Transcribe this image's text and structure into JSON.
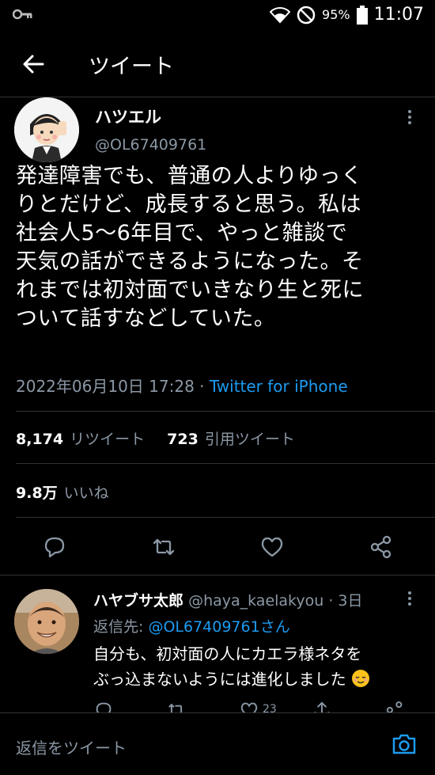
{
  "status": {
    "battery": "95%",
    "time": "11:07"
  },
  "header": {
    "title": "ツイート"
  },
  "tweet": {
    "name": "ハツエル",
    "handle": "@OL67409761",
    "lines": [
      "発達障害でも、普通の人よりゆっく",
      "りとだけど、成長すると思う。私は",
      "社会人5〜6年目で、やっと雑談で",
      "天気の話ができるようになった。そ",
      "れまでは初対面でいきなり生と死に",
      "ついて話すなどしていた。"
    ],
    "date": "2022年06月10日 17:28",
    "dot": "·",
    "source": "Twitter for iPhone",
    "retweets": "8,174",
    "retweets_label": "リツイート",
    "quotes": "723",
    "quotes_label": "引用ツイート",
    "likes": "9.8万",
    "likes_label": "いいね"
  },
  "reply": {
    "name": "ハヤブサ太郎",
    "handle": "@haya_kaelakyou",
    "time": "· 3日",
    "to_label": "返信先:",
    "to_mention": "@OL67409761さん",
    "line1": "自分も、初対面の人にカエラ様ネタを",
    "line2": "ぶっ込まないようには進化しました",
    "likes": "23"
  },
  "compose": {
    "placeholder": "返信をツイート"
  }
}
